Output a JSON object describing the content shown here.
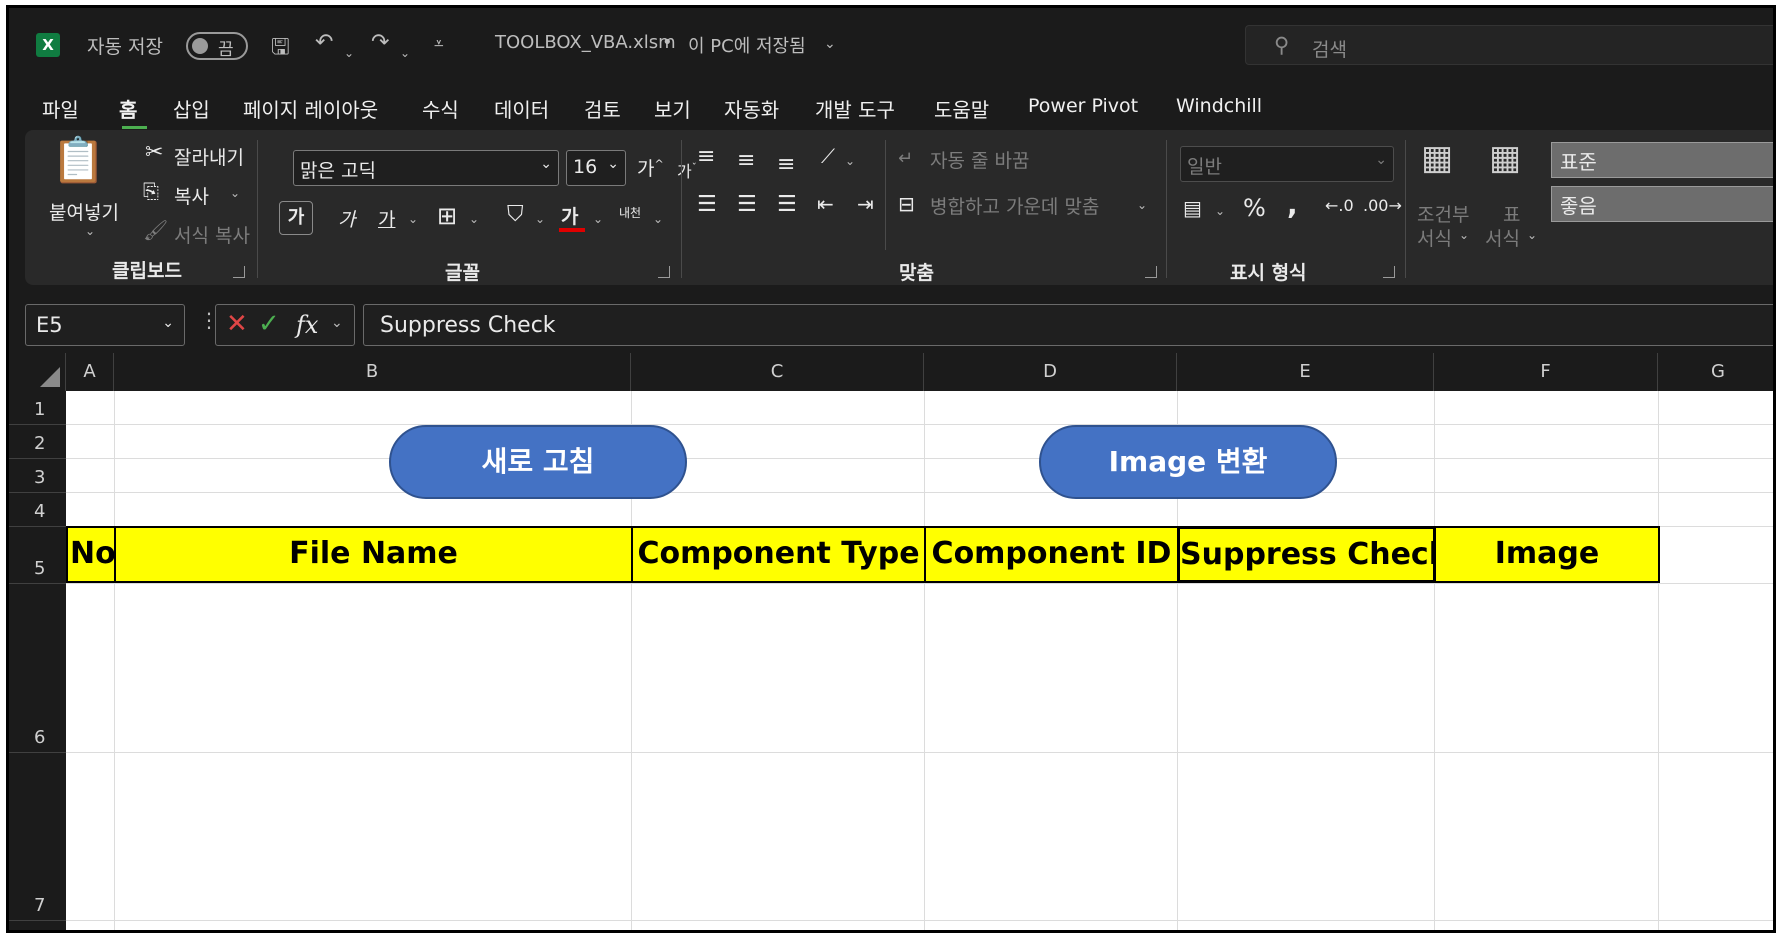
{
  "titlebar": {
    "autosave_label": "자동 저장",
    "autosave_state": "끔",
    "filename": "TOOLBOX_VBA.xlsm",
    "save_status": "이 PC에 저장됨",
    "search_placeholder": "검색"
  },
  "menu": {
    "tabs": [
      {
        "label": "파일"
      },
      {
        "label": "홈"
      },
      {
        "label": "삽입"
      },
      {
        "label": "페이지 레이아웃"
      },
      {
        "label": "수식"
      },
      {
        "label": "데이터"
      },
      {
        "label": "검토"
      },
      {
        "label": "보기"
      },
      {
        "label": "자동화"
      },
      {
        "label": "개발 도구"
      },
      {
        "label": "도움말"
      },
      {
        "label": "Power Pivot"
      },
      {
        "label": "Windchill"
      }
    ],
    "active_tab": "홈"
  },
  "ribbon": {
    "clipboard": {
      "group_label": "클립보드",
      "paste": "붙여넣기",
      "cut": "잘라내기",
      "copy": "복사",
      "format_painter": "서식 복사"
    },
    "font": {
      "group_label": "글꼴",
      "font_name": "맑은 고딕",
      "font_size": "16",
      "increase": "가",
      "decrease": "가",
      "bold": "가",
      "italic": "가",
      "underline": "가",
      "font_color_glyph": "가",
      "font_color": "#e00000",
      "phonetic": "내천"
    },
    "alignment": {
      "group_label": "맞춤",
      "wrap_text": "자동 줄 바꿈",
      "merge_center": "병합하고 가운데 맞춤"
    },
    "number": {
      "group_label": "표시 형식",
      "format": "일반"
    },
    "styles": {
      "conditional_line1": "조건부",
      "conditional_line2": "서식",
      "table_line1": "표",
      "table_line2": "서식",
      "style_normal": "표준",
      "style_good": "좋음"
    }
  },
  "formula_bar": {
    "name_box": "E5",
    "formula": "Suppress Check"
  },
  "sheet": {
    "columns": [
      "A",
      "B",
      "C",
      "D",
      "E",
      "F",
      "G"
    ],
    "rows": [
      "1",
      "2",
      "3",
      "4",
      "5",
      "6",
      "7"
    ],
    "header_row": [
      "No",
      "File Name",
      "Component Type",
      "Component ID",
      "Suppress Check",
      "Image"
    ],
    "header_fill": "#ffff00",
    "buttons": {
      "refresh": "새로 고침",
      "convert_image": "Image 변환"
    },
    "button_color": "#4472c4"
  }
}
